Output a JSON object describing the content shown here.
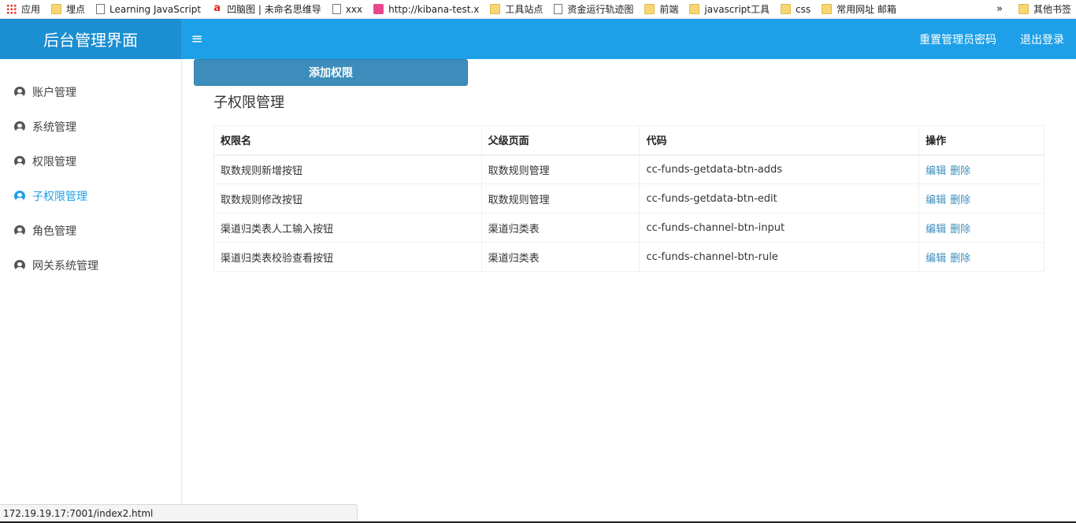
{
  "bookmarks": [
    {
      "label": "应用",
      "icon": "apps-icon"
    },
    {
      "label": "埋点",
      "icon": "folder-icon"
    },
    {
      "label": "Learning JavaScript",
      "icon": "page-icon"
    },
    {
      "label": "凹脑图 | 未命名思维导",
      "icon": "aonao-icon"
    },
    {
      "label": "xxx",
      "icon": "page-icon"
    },
    {
      "label": "http://kibana-test.x",
      "icon": "kibana-icon"
    },
    {
      "label": "工具站点",
      "icon": "folder-icon"
    },
    {
      "label": "资金运行轨迹图",
      "icon": "page-icon"
    },
    {
      "label": "前端",
      "icon": "folder-icon"
    },
    {
      "label": "javascript工具",
      "icon": "folder-icon"
    },
    {
      "label": "css",
      "icon": "folder-icon"
    },
    {
      "label": "常用网址 邮箱",
      "icon": "folder-icon"
    }
  ],
  "bookmarks_more": "»",
  "bookmarks_other": "其他书签",
  "header": {
    "logo": "后台管理界面",
    "menu_glyph": "≡",
    "reset_password": "重置管理员密码",
    "logout": "退出登录"
  },
  "sidebar": {
    "items": [
      {
        "label": "账户管理",
        "active": false
      },
      {
        "label": "系统管理",
        "active": false
      },
      {
        "label": "权限管理",
        "active": false
      },
      {
        "label": "子权限管理",
        "active": true
      },
      {
        "label": "角色管理",
        "active": false
      },
      {
        "label": "网关系统管理",
        "active": false
      }
    ]
  },
  "main": {
    "add_button": "添加权限",
    "title": "子权限管理",
    "table": {
      "headers": [
        "权限名",
        "父级页面",
        "代码",
        "操作"
      ],
      "rows": [
        {
          "name": "取数规则新增按钮",
          "parent": "取数规则管理",
          "code": "cc-funds-getdata-btn-adds"
        },
        {
          "name": "取数规则修改按钮",
          "parent": "取数规则管理",
          "code": "cc-funds-getdata-btn-edit"
        },
        {
          "name": "渠道归类表人工输入按钮",
          "parent": "渠道归类表",
          "code": "cc-funds-channel-btn-input"
        },
        {
          "name": "渠道归类表校验查看按钮",
          "parent": "渠道归类表",
          "code": "cc-funds-channel-btn-rule"
        }
      ],
      "edit_label": "编辑",
      "delete_label": "删除"
    }
  },
  "status_url": "172.19.19.17:7001/index2.html",
  "colors": {
    "header": "#1ea0e8",
    "logo_bg": "#1b8fd2",
    "button": "#3c8dbc",
    "active": "#1ea0e8"
  }
}
